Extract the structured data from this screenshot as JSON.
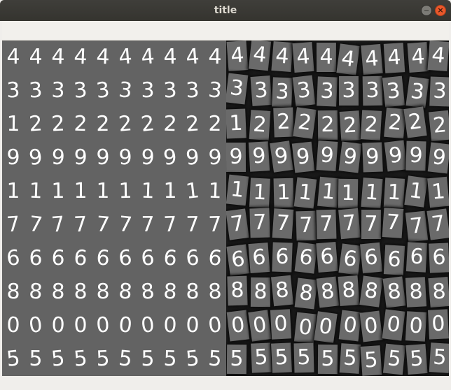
{
  "window": {
    "title": "title",
    "close_symbol": "×",
    "controls": [
      "minimize-icon",
      "close-icon"
    ]
  },
  "colors": {
    "titlebar": "#3a3935",
    "close_button": "#e9582b",
    "left_background": "#636363",
    "right_background": "#1c1c1c",
    "digit": "#ffffff"
  },
  "rows": [
    [
      "4",
      "4",
      "4",
      "4",
      "4",
      "4",
      "4",
      "4",
      "4",
      "4"
    ],
    [
      "3",
      "3",
      "3",
      "3",
      "3",
      "3",
      "3",
      "3",
      "3",
      "3"
    ],
    [
      "1",
      "2",
      "2",
      "2",
      "2",
      "2",
      "2",
      "2",
      "2",
      "2"
    ],
    [
      "9",
      "9",
      "9",
      "9",
      "9",
      "9",
      "9",
      "9",
      "9",
      "9"
    ],
    [
      "1",
      "1",
      "1",
      "1",
      "1",
      "1",
      "1",
      "1",
      "1",
      "1"
    ],
    [
      "7",
      "7",
      "7",
      "7",
      "7",
      "7",
      "7",
      "7",
      "7",
      "7"
    ],
    [
      "6",
      "6",
      "6",
      "6",
      "6",
      "6",
      "6",
      "6",
      "6",
      "6"
    ],
    [
      "8",
      "8",
      "8",
      "8",
      "8",
      "8",
      "8",
      "8",
      "8",
      "8"
    ],
    [
      "0",
      "0",
      "0",
      "0",
      "0",
      "0",
      "0",
      "0",
      "0",
      "0"
    ],
    [
      "5",
      "5",
      "5",
      "5",
      "5",
      "5",
      "5",
      "5",
      "5",
      "5"
    ]
  ]
}
